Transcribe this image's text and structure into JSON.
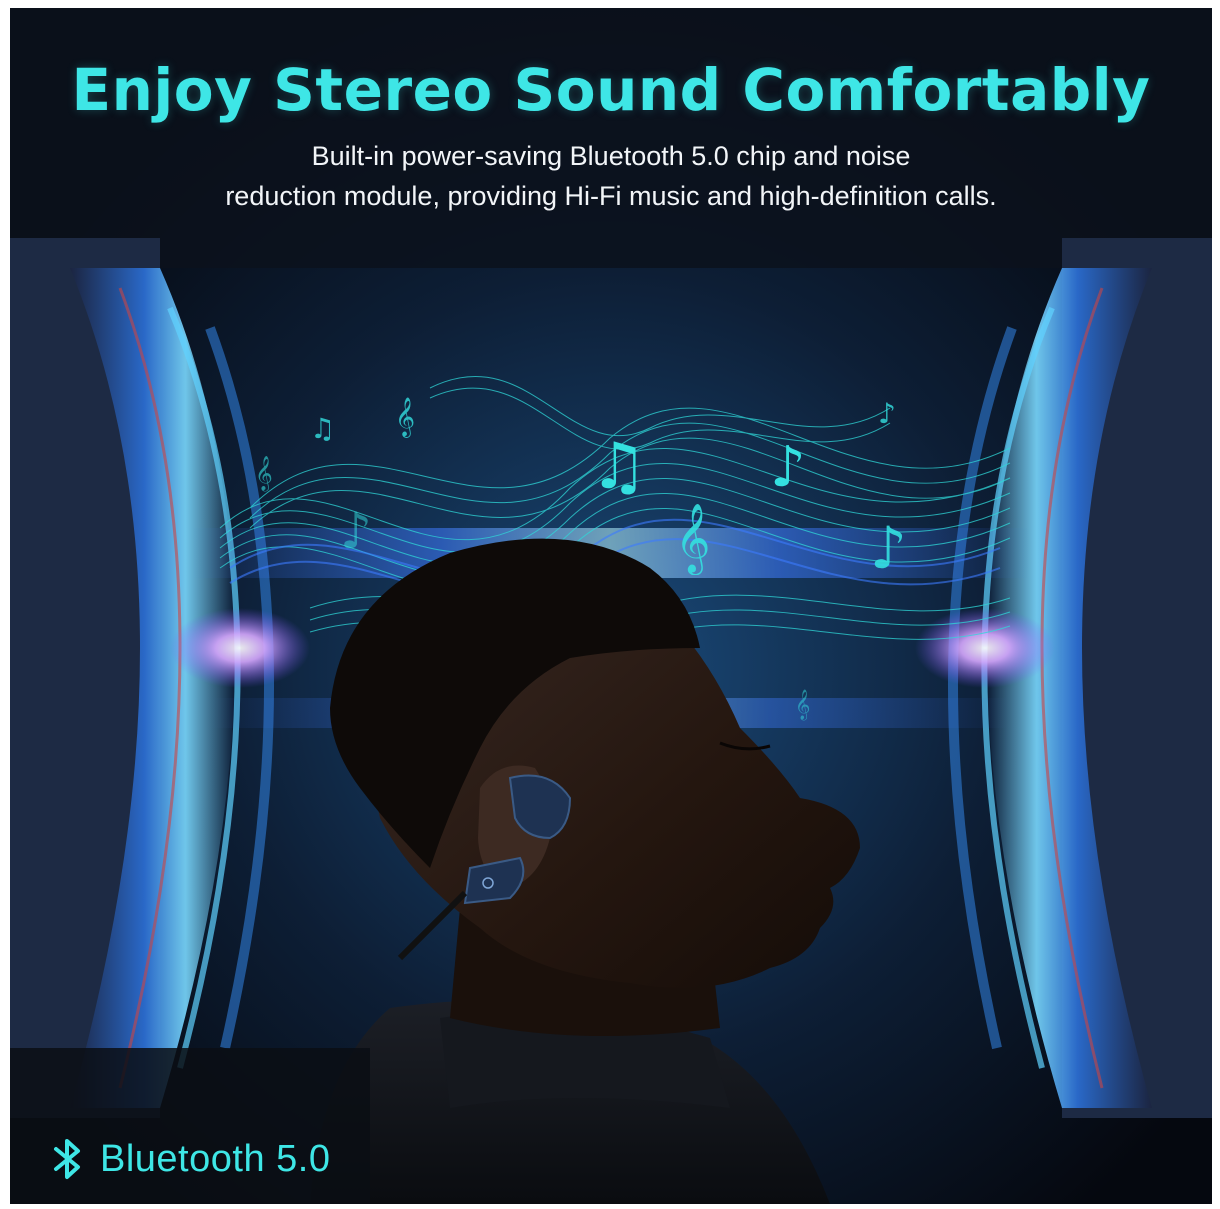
{
  "headline": "Enjoy Stereo Sound Comfortably",
  "subtext": {
    "line1": "Built-in power-saving Bluetooth 5.0 chip and noise",
    "line2": "reduction module, providing Hi-Fi music and high-definition calls."
  },
  "badge": {
    "icon": "bluetooth-icon",
    "label": "Bluetooth 5.0"
  },
  "colors": {
    "accent": "#3ee6e6",
    "background": "#0a0f1a",
    "wave": "#2fd8d8"
  }
}
